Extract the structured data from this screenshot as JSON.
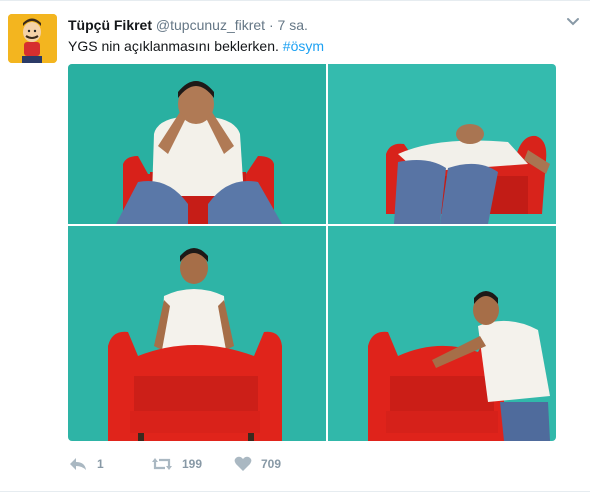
{
  "tweet": {
    "fullname": "Tüpçü Fikret",
    "username": "@tupcunuz_fikret",
    "separator": "·",
    "time": "7 sa.",
    "text": "YGS nin açıklanmasını beklerken. ",
    "hashtag": "#ösym",
    "icons": {
      "avatar": "cartoon-avatar",
      "more": "chevron-down-icon",
      "reply": "reply-icon",
      "retweet": "retweet-icon",
      "like": "heart-icon"
    },
    "actions": {
      "reply_count": "1",
      "retweet_count": "199",
      "like_count": "709"
    },
    "colors": {
      "hashtag": "#1da1f2",
      "muted": "#657786",
      "action": "#8899a6",
      "wall": "#2fb7aa",
      "armchair": "#e0221b"
    }
  }
}
